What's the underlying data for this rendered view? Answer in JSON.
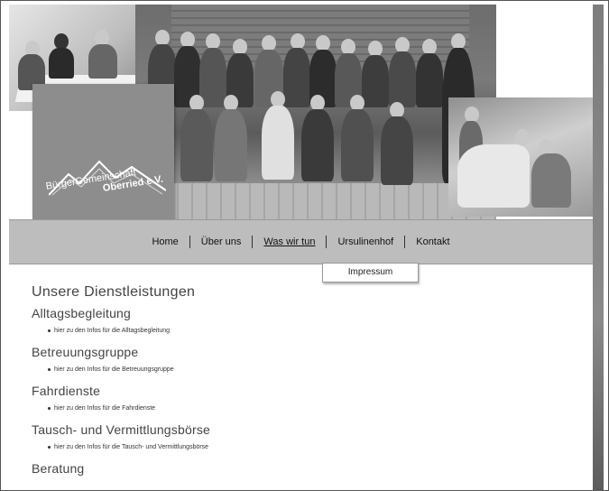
{
  "logo": {
    "line1": "BürgerGemeinschaft",
    "line2": "Oberried e.V."
  },
  "nav": {
    "items": [
      {
        "label": "Home"
      },
      {
        "label": "Über uns"
      },
      {
        "label": "Was wir tun"
      },
      {
        "label": "Ursulinenhof"
      },
      {
        "label": "Kontakt"
      }
    ],
    "submenu_label": "Impressum"
  },
  "content": {
    "title": "Unsere Dienstleistungen",
    "sections": [
      {
        "title": "Alltagsbegleitung",
        "link": "hier zu den Infos für die Alltagsbegleitung"
      },
      {
        "title": "Betreuungsgruppe",
        "link": "hier zu den Infos für die Betreuungsgruppe"
      },
      {
        "title": "Fahrdienste",
        "link": "hier zu den Infos für die Fahrdienste"
      },
      {
        "title": "Tausch- und Vermittlungsbörse",
        "link": "hier zu den Infos für die Tausch- und Vermittlungsbörse"
      },
      {
        "title": "Beratung",
        "link": ""
      }
    ]
  }
}
